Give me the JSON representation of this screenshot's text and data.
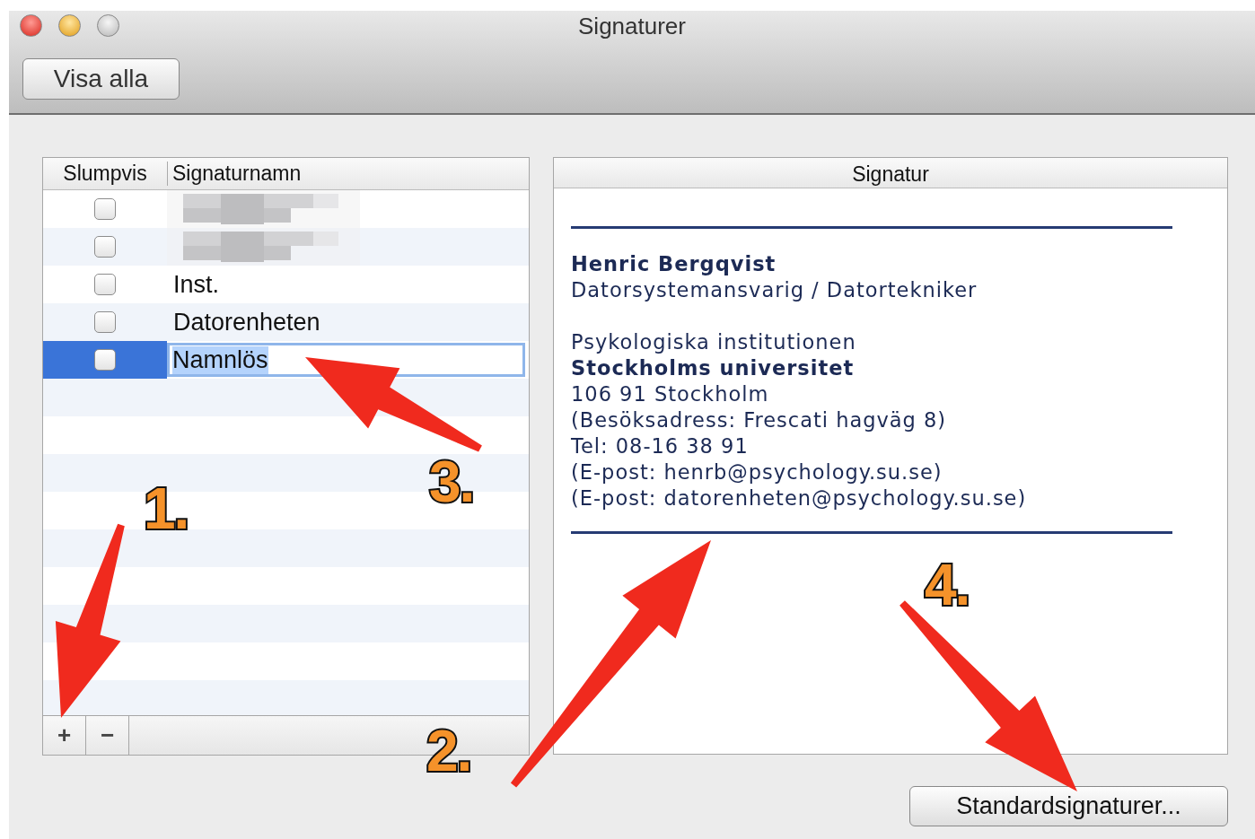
{
  "window": {
    "title": "Signaturer"
  },
  "toolbar": {
    "button": "Visa alla"
  },
  "table": {
    "columns": [
      "Slumpvis",
      "Signaturnamn"
    ],
    "rows": [
      {
        "kind": "redacted",
        "checked": false,
        "selected": false,
        "editing": false
      },
      {
        "kind": "redacted",
        "checked": false,
        "selected": false,
        "editing": false
      },
      {
        "kind": "text",
        "name": "Inst.",
        "checked": false,
        "selected": false,
        "editing": false
      },
      {
        "kind": "text",
        "name": "Datorenheten",
        "checked": false,
        "selected": false,
        "editing": false
      },
      {
        "kind": "text",
        "name": "Namnlös",
        "checked": false,
        "selected": true,
        "editing": true
      }
    ],
    "buttons": [
      "+",
      "−"
    ]
  },
  "signature": {
    "header": "Signatur",
    "blocks": [
      {
        "lines": [
          {
            "text": "Henric Bergqvist",
            "bold": true
          },
          {
            "text": "Datorsystemansvarig / Datortekniker",
            "bold": false
          }
        ]
      },
      {
        "lines": [
          {
            "text": "Psykologiska institutionen",
            "bold": false
          },
          {
            "text": "Stockholms universitet",
            "bold": true
          },
          {
            "text": "106 91 Stockholm",
            "bold": false
          },
          {
            "text": "(Besöksadress: Frescati hagväg 8)",
            "bold": false
          },
          {
            "text": "Tel: 08-16 38 91",
            "bold": false
          },
          {
            "text": "(E-post: henrb@psychology.su.se)",
            "bold": false
          },
          {
            "text": "(E-post: datorenheten@psychology.su.se)",
            "bold": false
          }
        ]
      }
    ]
  },
  "default_button": "Standardsignaturer...",
  "annotations": [
    {
      "label": "1."
    },
    {
      "label": "2."
    },
    {
      "label": "3."
    },
    {
      "label": "4."
    }
  ]
}
